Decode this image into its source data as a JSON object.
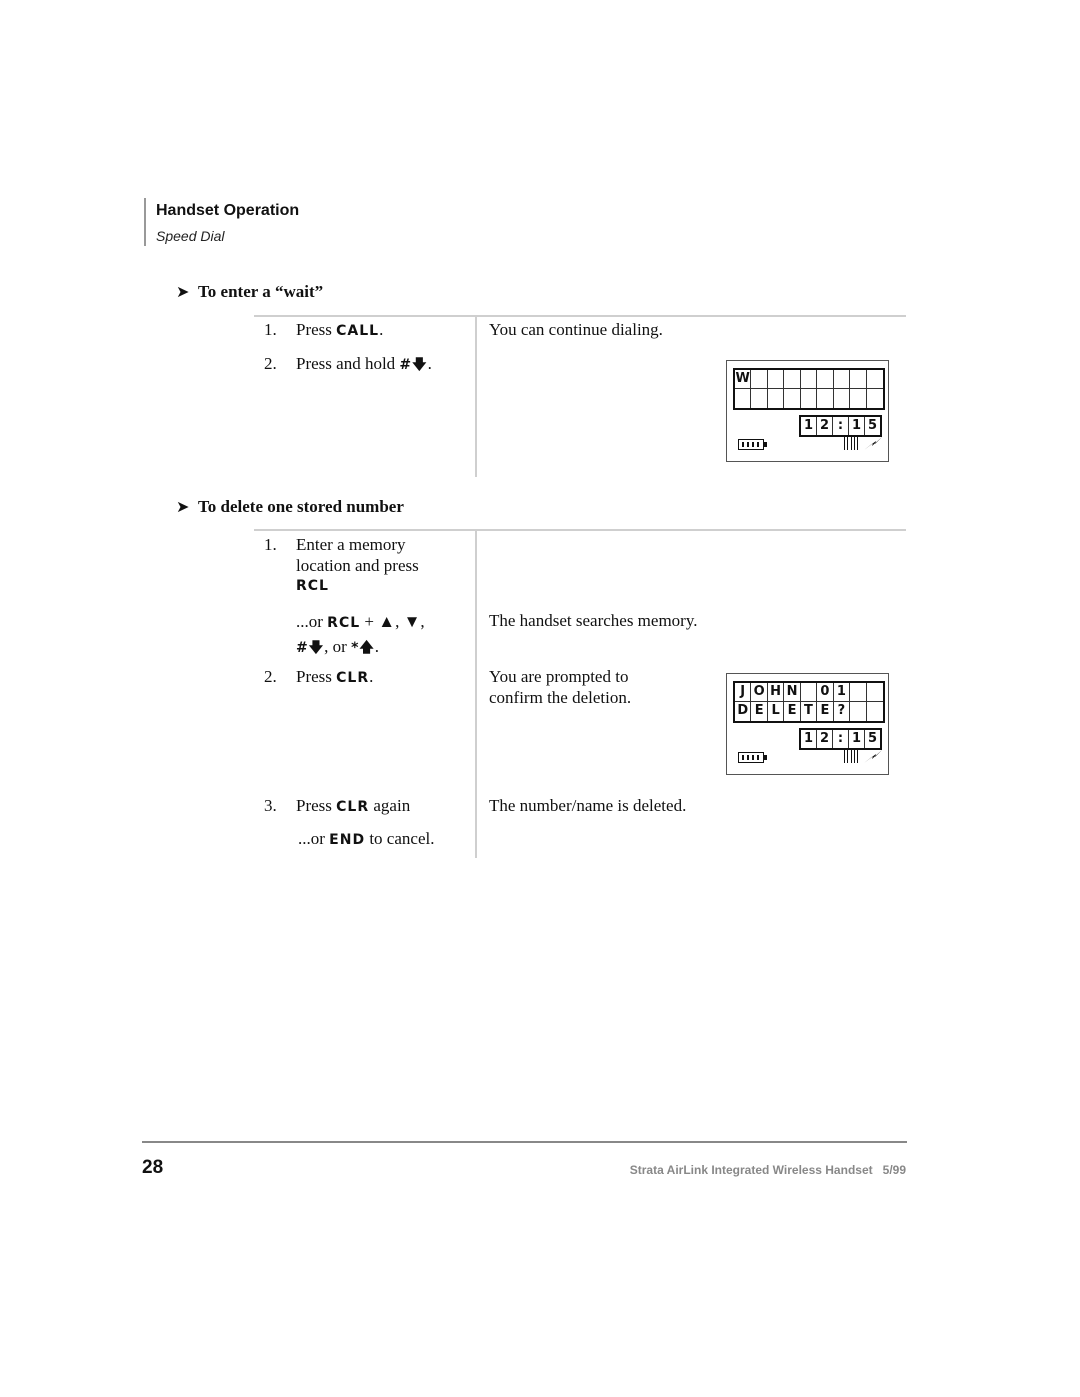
{
  "header": {
    "title": "Handset Operation",
    "subtitle": "Speed Dial"
  },
  "sections": [
    {
      "heading": "To enter a “wait”",
      "steps": [
        {
          "num": "1.",
          "pre": "Press ",
          "key": "CALL",
          "post": "."
        },
        {
          "num": "2.",
          "pre": "Press and hold ",
          "key": "#",
          "icon": "arrow-down",
          "post": "."
        }
      ],
      "result": "You can continue dialing.",
      "display": {
        "row1": [
          "W",
          "",
          "",
          "",
          "",
          "",
          "",
          "",
          ""
        ],
        "row2": [
          "",
          "",
          "",
          "",
          "",
          "",
          "",
          "",
          ""
        ],
        "clock": [
          "1",
          "2",
          ":",
          "1",
          "5"
        ]
      }
    },
    {
      "heading": "To delete one stored number",
      "step1": {
        "num": "1.",
        "line1": "Enter a memory",
        "line2": "location and press",
        "key": "RCL"
      },
      "step1_alt": {
        "pre": "...or ",
        "key": "RCL",
        "plus": " + ",
        "sep1": ", ",
        "sep2": ",",
        "hash": "#",
        "or": ", or ",
        "star": "*",
        "end": "."
      },
      "step1_result": "The handset searches memory.",
      "step2": {
        "num": "2.",
        "pre": "Press ",
        "key": "CLR",
        "post": "."
      },
      "step2_result_l1": "You are prompted to",
      "step2_result_l2": "confirm the deletion.",
      "display": {
        "row1": [
          "J",
          "O",
          "H",
          "N",
          "",
          "0",
          "1",
          "",
          ""
        ],
        "row2": [
          "D",
          "E",
          "L",
          "E",
          "T",
          "E",
          "?",
          "",
          ""
        ],
        "clock": [
          "1",
          "2",
          ":",
          "1",
          "5"
        ]
      },
      "step3": {
        "num": "3.",
        "pre": "Press ",
        "key": "CLR",
        "post": " again"
      },
      "step3_alt": {
        "pre": "...or ",
        "key": "END",
        "post": " to cancel."
      },
      "step3_result": "The number/name is deleted."
    }
  ],
  "footer": {
    "page_number": "28",
    "doc_title": "Strata AirLink Integrated Wireless Handset",
    "date": "5/99"
  }
}
